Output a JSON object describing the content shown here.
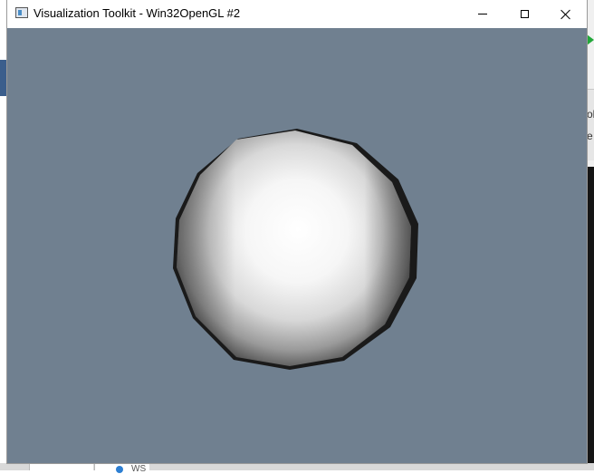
{
  "window": {
    "title": "Visualization Toolkit - Win32OpenGL #2",
    "icon": "vtk-window-icon",
    "controls": {
      "minimize": "minimize-icon",
      "maximize": "maximize-icon",
      "close": "close-icon"
    }
  },
  "viewport": {
    "background_color": "#708090",
    "object": "sphere",
    "object_color": "#ffffff"
  },
  "background_app": {
    "fragment_1": "ol",
    "fragment_2": "e",
    "taskbar_label": "WS"
  }
}
